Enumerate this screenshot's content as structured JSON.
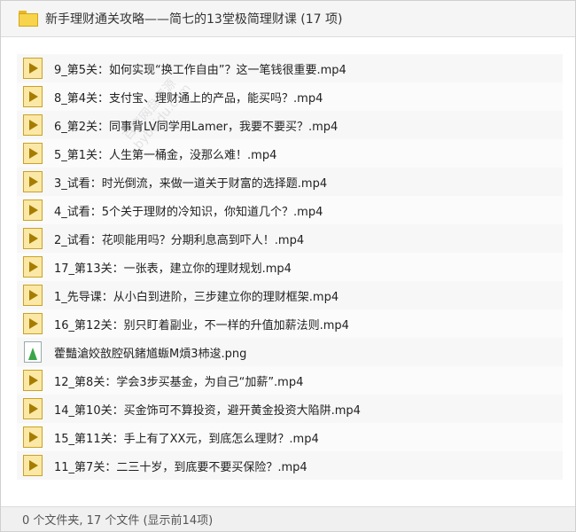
{
  "window": {
    "title": "新手理财通关攻略——简七的13堂极简理财课 (17 项)",
    "folder_icon": "folder-icon"
  },
  "files": [
    {
      "name": "9_第5关：如何实现“换工作自由”？这一笔钱很重要.mp4",
      "type": "video"
    },
    {
      "name": "8_第4关：支付宝、理财通上的产品，能买吗？.mp4",
      "type": "video"
    },
    {
      "name": "6_第2关：同事背LV同学用Lamer，我要不要买？.mp4",
      "type": "video"
    },
    {
      "name": "5_第1关：人生第一桶金，没那么难！.mp4",
      "type": "video"
    },
    {
      "name": "3_试看：时光倒流，来做一道关于财富的选择题.mp4",
      "type": "video"
    },
    {
      "name": "4_试看：5个关于理财的冷知识，你知道几个？.mp4",
      "type": "video"
    },
    {
      "name": "2_试看：花呗能用吗？分期利息高到吓人！.mp4",
      "type": "video"
    },
    {
      "name": "17_第13关：一张表，建立你的理财规划.mp4",
      "type": "video"
    },
    {
      "name": "1_先导课：从小白到进阶，三步建立你的理财框架.mp4",
      "type": "video"
    },
    {
      "name": "16_第12关：别只盯着副业，不一样的升值加薪法则.mp4",
      "type": "video"
    },
    {
      "name": "藿豔滄姣敨腔矾鍺馗蝂M熕3杮逡.png",
      "type": "image"
    },
    {
      "name": "12_第8关：学会3步买基金，为自己“加薪”.mp4",
      "type": "video"
    },
    {
      "name": "14_第10关：买金饰可不算投资，避开黄金投资大陷阱.mp4",
      "type": "video"
    },
    {
      "name": "15_第11关：手上有了XX元，到底怎么理财？.mp4",
      "type": "video"
    },
    {
      "name": "11_第7关：二三十岁，到底要不要买保险？.mp4",
      "type": "video"
    }
  ],
  "watermark": {
    "line1": "百度网盘资源",
    "line2": "bybaidu.com"
  },
  "status": {
    "text": "0 个文件夹, 17 个文件 (显示前14项)"
  }
}
